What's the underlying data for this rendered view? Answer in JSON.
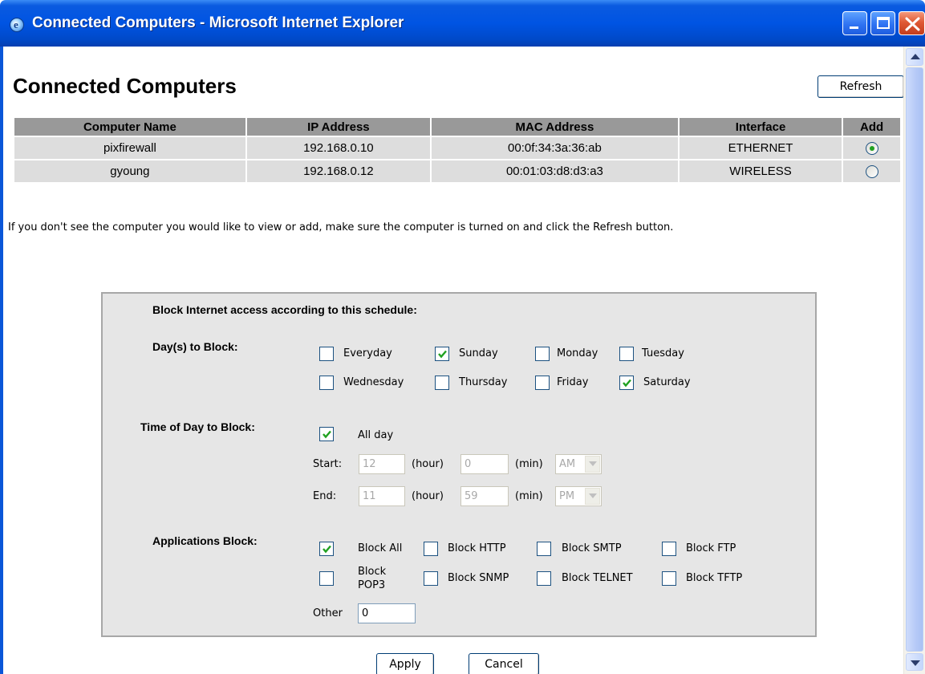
{
  "window": {
    "title": "Connected Computers - Microsoft Internet Explorer",
    "app_icon": "ie-icon",
    "accent_color": "#0054e3"
  },
  "page": {
    "title": "Connected Computers",
    "refresh_label": "Refresh"
  },
  "computers_table": {
    "headers": [
      "Computer Name",
      "IP Address",
      "MAC Address",
      "Interface",
      "Add"
    ],
    "rows": [
      {
        "name": "pixfirewall",
        "ip": "192.168.0.10",
        "mac": "00:0f:34:3a:36:ab",
        "interface": "ETHERNET",
        "selected": true
      },
      {
        "name": "gyoung",
        "ip": "192.168.0.12",
        "mac": "00:01:03:d8:d3:a3",
        "interface": "WIRELESS",
        "selected": false
      }
    ]
  },
  "help_text": "If you don't see the computer you would like to view or add, make sure the computer is turned on and click the Refresh button.",
  "schedule": {
    "heading": "Block Internet access according to this schedule:",
    "days_label": "Day(s) to Block:",
    "days": [
      {
        "label": "Everyday",
        "checked": false
      },
      {
        "label": "Sunday",
        "checked": true
      },
      {
        "label": "Monday",
        "checked": false
      },
      {
        "label": "Tuesday",
        "checked": false
      },
      {
        "label": "Wednesday",
        "checked": false
      },
      {
        "label": "Thursday",
        "checked": false
      },
      {
        "label": "Friday",
        "checked": false
      },
      {
        "label": "Saturday",
        "checked": true
      }
    ],
    "time_label": "Time of Day to Block:",
    "all_day": {
      "label": "All day",
      "checked": true
    },
    "start": {
      "label": "Start:",
      "hour": "12",
      "hour_unit": "(hour)",
      "min": "0",
      "min_unit": "(min)",
      "ampm": "AM"
    },
    "end": {
      "label": "End:",
      "hour": "11",
      "hour_unit": "(hour)",
      "min": "59",
      "min_unit": "(min)",
      "ampm": "PM"
    },
    "apps_label": "Applications Block:",
    "apps": [
      {
        "label": "Block All",
        "checked": true
      },
      {
        "label": "Block HTTP",
        "checked": false
      },
      {
        "label": "Block SMTP",
        "checked": false
      },
      {
        "label": "Block FTP",
        "checked": false
      },
      {
        "label_line1": "Block",
        "label_line2": "POP3",
        "checked": false
      },
      {
        "label": "Block SNMP",
        "checked": false
      },
      {
        "label": "Block TELNET",
        "checked": false
      },
      {
        "label": "Block TFTP",
        "checked": false
      }
    ],
    "other_label": "Other",
    "other_value": "0"
  },
  "actions": {
    "apply_label": "Apply",
    "cancel_label": "Cancel"
  }
}
